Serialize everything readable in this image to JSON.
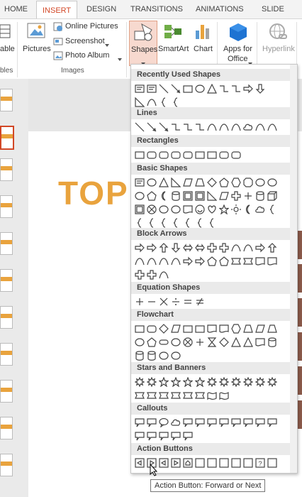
{
  "tabs": [
    "HOME",
    "INSERT",
    "DESIGN",
    "TRANSITIONS",
    "ANIMATIONS",
    "SLIDE SHOW"
  ],
  "ribbon": {
    "table_label": "able",
    "tables_group": "bles",
    "pictures_label": "Pictures",
    "online_pictures_label": "Online Pictures",
    "screenshot_label": "Screenshot",
    "photo_album_label": "Photo Album",
    "images_group": "Images",
    "shapes_label": "Shapes",
    "smartart_label": "SmartArt",
    "chart_label": "Chart",
    "apps_label_1": "Apps for",
    "apps_label_2": "Office",
    "hyperlink_label": "Hyperlink"
  },
  "slide": {
    "title": "TOP"
  },
  "gallery": {
    "sections": [
      "Recently Used Shapes",
      "Lines",
      "Rectangles",
      "Basic Shapes",
      "Block Arrows",
      "Equation Shapes",
      "Flowchart",
      "Stars and Banners",
      "Callouts",
      "Action Buttons"
    ]
  },
  "tooltip": "Action Button: Forward or Next",
  "colors": {
    "accent": "#d24726",
    "title": "#e9a33d"
  }
}
